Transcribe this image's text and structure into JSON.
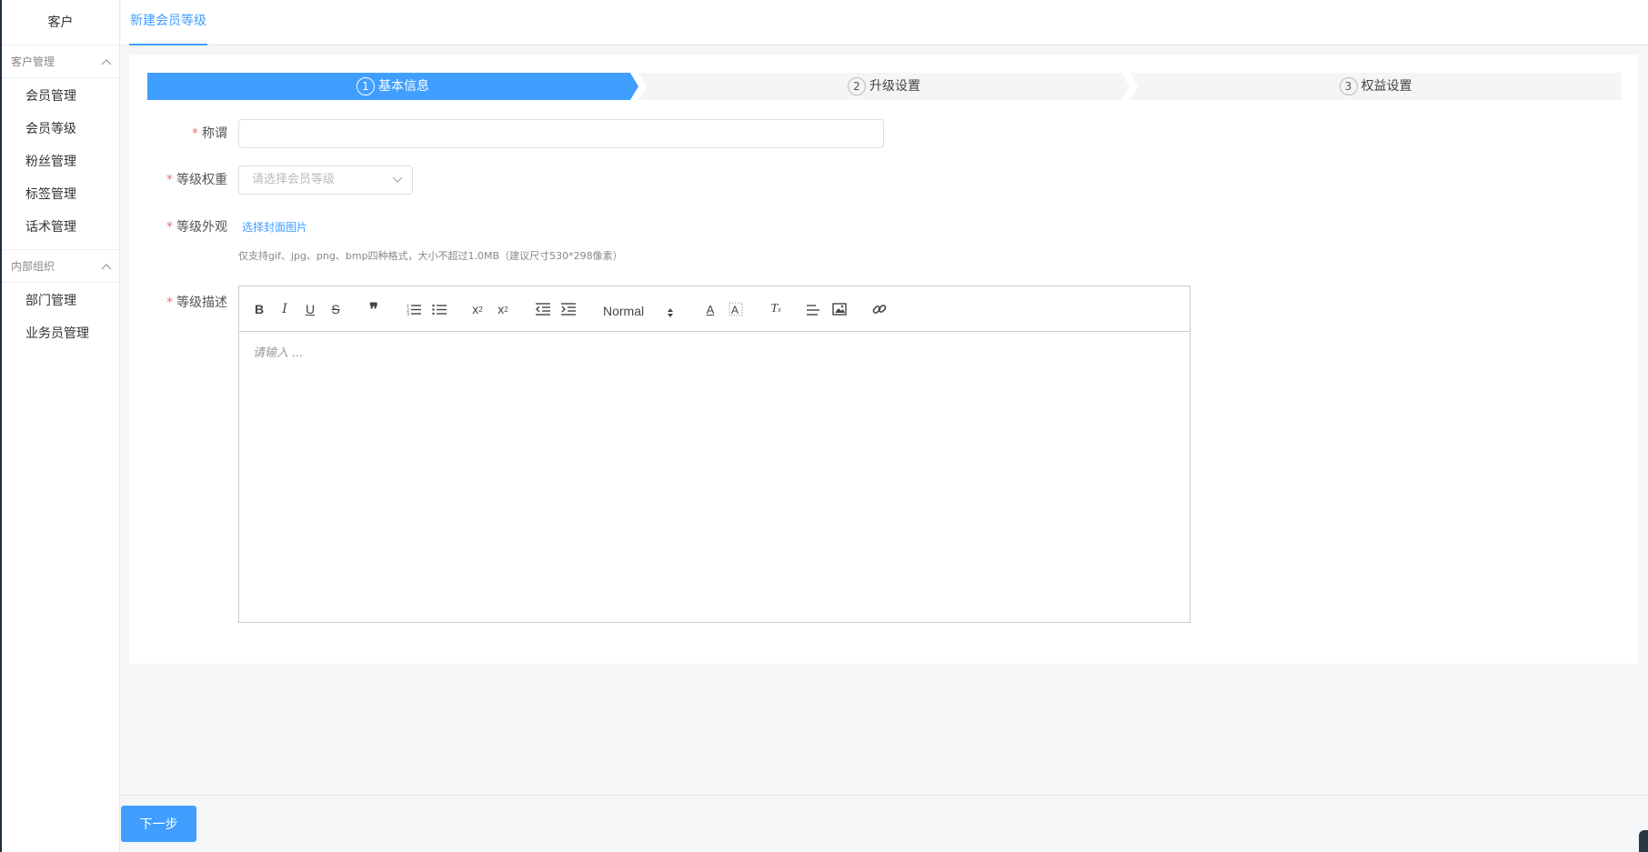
{
  "sidebar": {
    "title": "客户",
    "groups": [
      {
        "label": "客户管理",
        "items": [
          "会员管理",
          "会员等级",
          "粉丝管理",
          "标签管理",
          "话术管理"
        ]
      },
      {
        "label": "内部组织",
        "items": [
          "部门管理",
          "业务员管理"
        ]
      }
    ]
  },
  "tabs": [
    {
      "label": "新建会员等级",
      "active": true
    }
  ],
  "steps": [
    {
      "num": "1",
      "label": "基本信息",
      "active": true
    },
    {
      "num": "2",
      "label": "升级设置",
      "active": false
    },
    {
      "num": "3",
      "label": "权益设置",
      "active": false
    }
  ],
  "form": {
    "name": {
      "label": "称谓",
      "value": ""
    },
    "weight": {
      "label": "等级权重",
      "placeholder": "请选择会员等级"
    },
    "appearance": {
      "label": "等级外观",
      "link": "选择封面图片",
      "hint": "仅支持gif、jpg、png、bmp四种格式，大小不超过1.0MB（建议尺寸530*298像素）"
    },
    "description": {
      "label": "等级描述",
      "editor_placeholder": "请输入 ...",
      "header_select": "Normal"
    }
  },
  "footer": {
    "next_button": "下一步"
  },
  "colors": {
    "primary": "#409eff",
    "required": "#f56c6c"
  }
}
